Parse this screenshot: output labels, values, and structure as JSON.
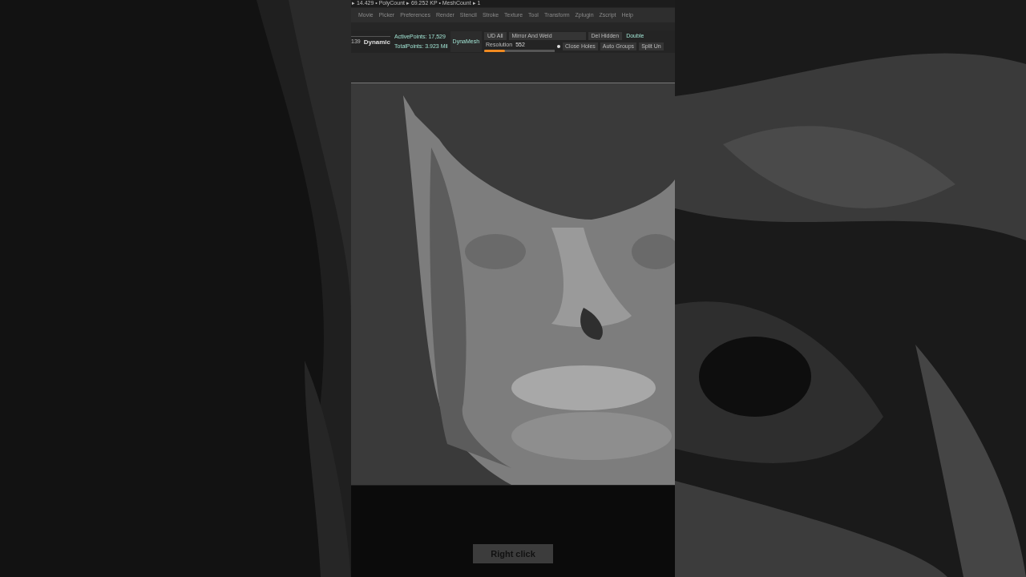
{
  "status_line": {
    "items": [
      "▸ 14.429 • PolyCount ▸ 69.252 KP • MeshCount ▸ 1"
    ]
  },
  "menu": [
    "Movie",
    "Picker",
    "Preferences",
    "Render",
    "Stencil",
    "Stroke",
    "Texture",
    "Tool",
    "Transform",
    "Zplugin",
    "Zscript",
    "Help"
  ],
  "toolbar": {
    "left_value": "139",
    "dynamic_button": "Dynamic",
    "active_points": "ActivePoints: 17,529",
    "total_points": "TotalPoints: 3.923 Mil",
    "dynamesh_button": "DynaMesh",
    "buttons_row_1": [
      {
        "label": "UD All",
        "kind": "button"
      },
      {
        "label": "Mirror And Weld",
        "kind": "wide"
      },
      {
        "label": "Del Hidden",
        "kind": "button"
      },
      {
        "label": "Double",
        "kind": "toggle"
      }
    ],
    "resolution": {
      "label": "Resolution",
      "value": "552",
      "level": 0.3
    },
    "buttons_row_2": [
      "Close Holes",
      "Auto Groups",
      "Split Un"
    ]
  },
  "caption": "Right click"
}
